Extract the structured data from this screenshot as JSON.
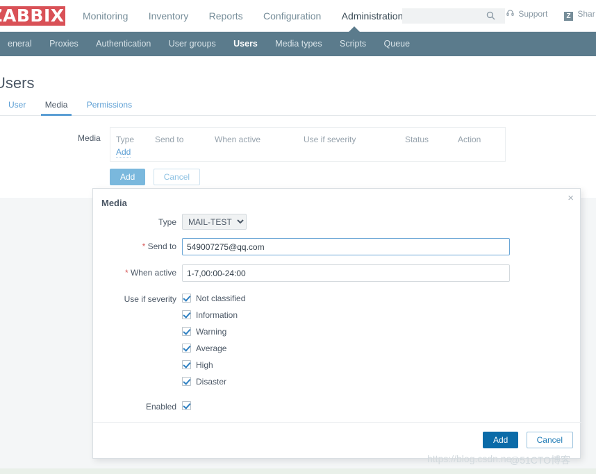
{
  "header": {
    "logo": "ZABBIX",
    "nav": [
      {
        "label": "Monitoring",
        "active": false
      },
      {
        "label": "Inventory",
        "active": false
      },
      {
        "label": "Reports",
        "active": false
      },
      {
        "label": "Configuration",
        "active": false
      },
      {
        "label": "Administration",
        "active": true
      }
    ],
    "search_placeholder": "",
    "search_value": "",
    "search_icon": "search-icon",
    "support_label": "Support",
    "support_icon": "headset-icon",
    "share_label": "Shar",
    "share_badge": "Z"
  },
  "subnav": {
    "items": [
      {
        "label": "eneral",
        "active": false
      },
      {
        "label": "Proxies",
        "active": false
      },
      {
        "label": "Authentication",
        "active": false
      },
      {
        "label": "User groups",
        "active": false
      },
      {
        "label": "Users",
        "active": true
      },
      {
        "label": "Media types",
        "active": false
      },
      {
        "label": "Scripts",
        "active": false
      },
      {
        "label": "Queue",
        "active": false
      }
    ]
  },
  "page": {
    "title": "Users",
    "form_tabs": [
      {
        "label": "User",
        "active": false
      },
      {
        "label": "Media",
        "active": true
      },
      {
        "label": "Permissions",
        "active": false
      }
    ],
    "media_section": {
      "label": "Media",
      "columns": [
        "Type",
        "Send to",
        "When active",
        "Use if severity",
        "Status",
        "Action"
      ],
      "add_link": "Add",
      "rows": []
    },
    "actions": {
      "add_label": "Add",
      "cancel_label": "Cancel"
    }
  },
  "modal": {
    "title": "Media",
    "close_icon": "×",
    "type": {
      "label": "Type",
      "value": "MAIL-TEST",
      "options": [
        "MAIL-TEST"
      ]
    },
    "send_to": {
      "label": "Send to",
      "required": "*",
      "value": "549007275@qq.com",
      "placeholder": ""
    },
    "when_active": {
      "label": "When active",
      "required": "*",
      "value": "1-7,00:00-24:00",
      "placeholder": ""
    },
    "use_if_severity": {
      "label": "Use if severity",
      "options": [
        {
          "label": "Not classified",
          "checked": true
        },
        {
          "label": "Information",
          "checked": true
        },
        {
          "label": "Warning",
          "checked": true
        },
        {
          "label": "Average",
          "checked": true
        },
        {
          "label": "High",
          "checked": true
        },
        {
          "label": "Disaster",
          "checked": true
        }
      ]
    },
    "enabled": {
      "label": "Enabled",
      "checked": true
    },
    "footer": {
      "add_label": "Add",
      "cancel_label": "Cancel"
    }
  },
  "watermark": {
    "text_a": "https://blog.csdn.ne",
    "text_b": "@51CTO博客"
  },
  "colors": {
    "brand_red": "#d95157",
    "subnav_teal": "#5b7b8c",
    "accent_blue": "#5b9ed4",
    "button_blue": "#0b6ba8",
    "required_red": "#d75b5b"
  }
}
